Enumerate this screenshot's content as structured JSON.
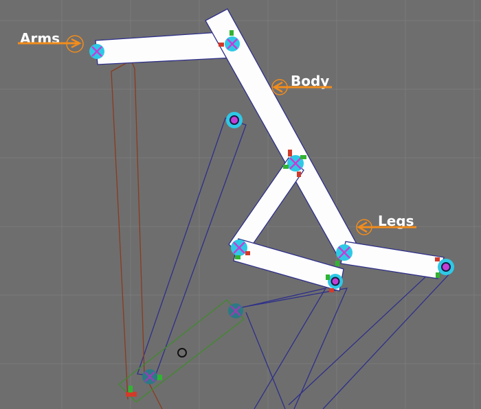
{
  "labels": {
    "arms": "Arms",
    "body": "Body",
    "legs": "Legs"
  },
  "colors": {
    "background": "#6e6e6e",
    "grid": "#7b7b7b",
    "bone_fill": "#fdfdfd",
    "bone_outline": "#2e2f8a",
    "ik_chain": "#2e2f8a",
    "arm_chain": "#8a3a1e",
    "selected_outline": "#3f8a2c",
    "joint_fill": "#2ec9e6",
    "joint_cross": "#c23fd6",
    "callout": "#f28c1b",
    "label_text": "#ffffff"
  },
  "icons": {
    "joint": "joint-cross-icon",
    "pivot": "pivot-circle-icon",
    "callout": "arrow-callout-icon"
  }
}
